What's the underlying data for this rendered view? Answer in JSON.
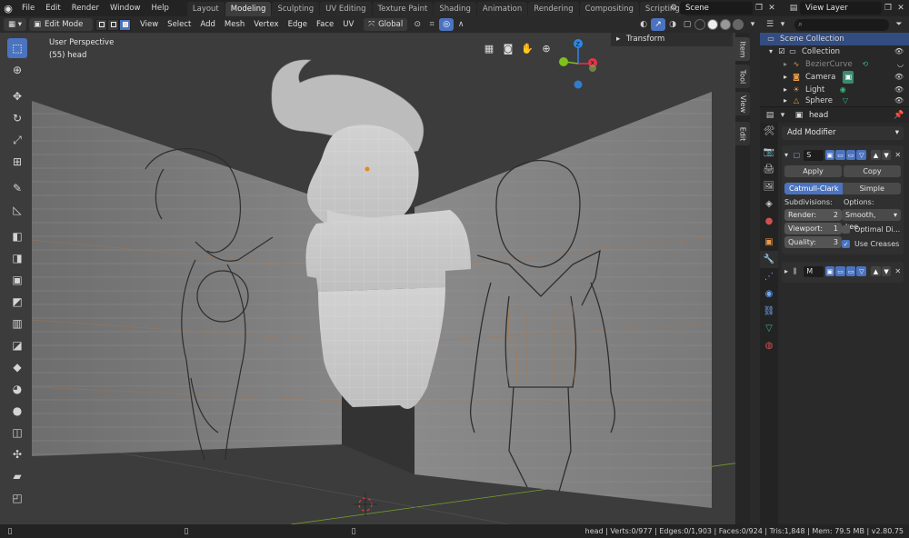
{
  "topbar": {
    "menus": [
      "File",
      "Edit",
      "Render",
      "Window",
      "Help"
    ],
    "workspaces": [
      "Layout",
      "Modeling",
      "Sculpting",
      "UV Editing",
      "Texture Paint",
      "Shading",
      "Animation",
      "Rendering",
      "Compositing",
      "Scripting"
    ],
    "active_workspace": "Modeling",
    "add_workspace": "+",
    "scene": "Scene",
    "view_layer": "View Layer"
  },
  "viewport_header": {
    "mode": "Edit Mode",
    "menus": [
      "View",
      "Select",
      "Add",
      "Mesh",
      "Vertex",
      "Edge",
      "Face",
      "UV"
    ],
    "orientation": "Global"
  },
  "viewport": {
    "perspective_label": "User Perspective",
    "object_label": "(55) head",
    "transform_panel": "Transform",
    "side_tabs": [
      "Item",
      "Tool",
      "View",
      "Edit"
    ],
    "gizmo_axes": {
      "x": "X",
      "y": "Y",
      "z": "Z"
    },
    "colors": {
      "x_axis": "#e5334b",
      "y_axis": "#7ec11b",
      "z_axis": "#2e87e6",
      "accent": "#4b73bf"
    }
  },
  "toolbar": {
    "tools": [
      "select-box",
      "cursor",
      "move",
      "rotate",
      "scale",
      "transform",
      "annotate",
      "measure",
      "add-cube",
      "extrude",
      "inset",
      "bevel",
      "loop-cut",
      "knife",
      "poly-build",
      "spin",
      "smooth",
      "edge-slide",
      "shrink-fatten",
      "shear",
      "rip-region"
    ]
  },
  "outliner": {
    "search_placeholder": "",
    "rows": [
      {
        "label": "Scene Collection",
        "icon": "collection-icon"
      },
      {
        "label": "Collection",
        "icon": "collection-icon"
      },
      {
        "label": "BezierCurve",
        "icon": "curve-icon"
      },
      {
        "label": "Camera",
        "icon": "camera-icon"
      },
      {
        "label": "Light",
        "icon": "light-icon"
      },
      {
        "label": "Sphere",
        "icon": "mesh-icon"
      }
    ]
  },
  "properties": {
    "object_name": "head",
    "add_modifier": "Add Modifier",
    "modifier1": {
      "name_short": "S",
      "apply": "Apply",
      "copy": "Copy",
      "type_options": [
        "Catmull-Clark",
        "Simple"
      ],
      "active_type": "Catmull-Clark",
      "subdivisions_label": "Subdivisions:",
      "options_label": "Options:",
      "render_label": "Render:",
      "render_value": "2",
      "viewport_label": "Viewport:",
      "viewport_value": "1",
      "quality_label": "Quality:",
      "quality_value": "3",
      "uv_smooth": "Smooth, kee...",
      "optimal_display": "Optimal Di...",
      "use_creases": "Use Creases"
    },
    "modifier2": {
      "name_short": "M"
    }
  },
  "statusbar": {
    "text": "head | Verts:0/977 | Edges:0/1,903 | Faces:0/924 | Tris:1,848 | Mem: 79.5 MB | v2.80.75"
  }
}
